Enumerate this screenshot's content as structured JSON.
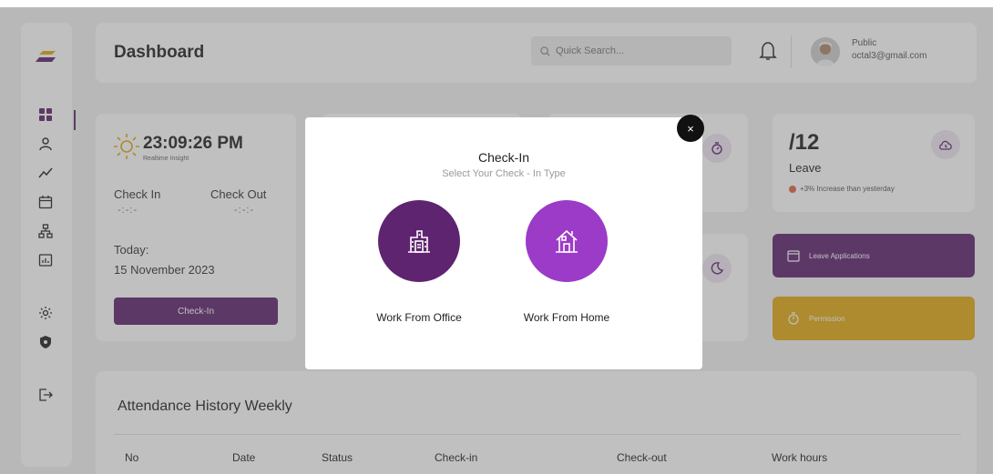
{
  "header": {
    "title": "Dashboard",
    "search_placeholder": "Quick Search...",
    "user_name": "Public",
    "user_email": "octal3@gmail.com"
  },
  "sidebar": {
    "items": [
      {
        "icon": "grid-icon"
      },
      {
        "icon": "user-icon"
      },
      {
        "icon": "trend-icon"
      },
      {
        "icon": "calendar-icon"
      },
      {
        "icon": "hierarchy-icon"
      },
      {
        "icon": "report-icon"
      },
      {
        "icon": "gear-icon"
      },
      {
        "icon": "shield-icon"
      },
      {
        "icon": "logout-icon"
      }
    ]
  },
  "time_card": {
    "time": "23:09:26 PM",
    "subtitle": "Realtime Insight",
    "check_in_label": "Check In",
    "check_out_label": "Check Out",
    "check_in_value": "-:-:-",
    "check_out_value": "-:-:-",
    "today_label": "Today:",
    "date": "15 November 2023",
    "button": "Check-In"
  },
  "leave_card": {
    "value": "/12",
    "label": "Leave",
    "trend": "+3% Increase than yesterday"
  },
  "actions": {
    "leave_applications": "Leave Applications",
    "permission": "Permission"
  },
  "attendance": {
    "title": "Attendance History Weekly",
    "columns": [
      "No",
      "Date",
      "Status",
      "Check-in",
      "Check-out",
      "Work hours"
    ]
  },
  "modal": {
    "title": "Check-In",
    "subtitle": "Select Your Check - In Type",
    "option_office": "Work From Office",
    "option_home": "Work From Home",
    "close": "×"
  },
  "colors": {
    "primary": "#5e2470",
    "secondary": "#9b3bc7",
    "permission": "#e0aa14",
    "overlay": "rgba(90,90,90,0.38)"
  }
}
